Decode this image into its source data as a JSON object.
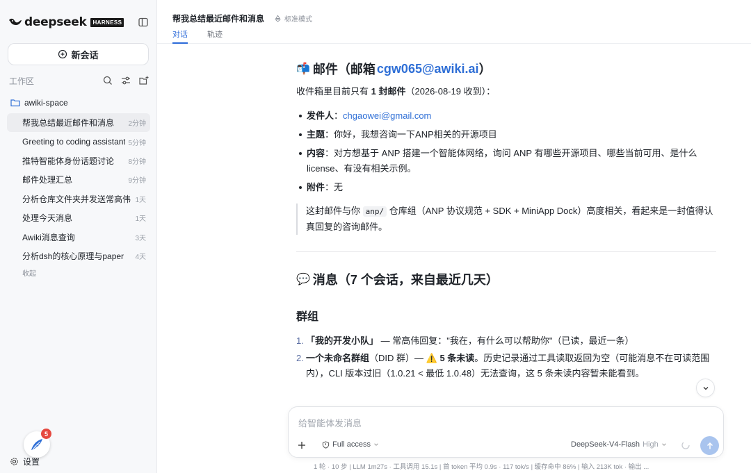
{
  "brand": {
    "name": "deepseek",
    "badge": "HARNESS"
  },
  "sidebar": {
    "new_chat_label": "新会话",
    "workspace_label": "工作区",
    "folder_name": "awiki-space",
    "conversations": [
      {
        "title": "帮我总结最近邮件和消息",
        "ago": "2分钟",
        "active": true
      },
      {
        "title": "Greeting to coding assistant",
        "ago": "5分钟"
      },
      {
        "title": "推特智能体身份话题讨论",
        "ago": "8分钟"
      },
      {
        "title": "邮件处理汇总",
        "ago": "9分钟"
      },
      {
        "title": "分析仓库文件夹并发送常高伟",
        "ago": "1天"
      },
      {
        "title": "处理今天消息",
        "ago": "1天"
      },
      {
        "title": "Awiki消息查询",
        "ago": "3天"
      },
      {
        "title": "分析dsh的核心原理与paper",
        "ago": "4天"
      }
    ],
    "collapse_label": "收起",
    "notification_count": "5",
    "settings_label": "设置"
  },
  "header": {
    "title": "帮我总结最近邮件和消息",
    "mode_label": "标准模式",
    "tabs": [
      "对话",
      "轨迹"
    ]
  },
  "content": {
    "mail_heading_emoji": "📬",
    "mail_heading": "邮件（邮箱 ",
    "mail_heading_email": "cgw065@awiki.ai",
    "mail_heading_end": "）",
    "inbox_prefix": "收件箱里目前只有 ",
    "inbox_count": "1 封邮件",
    "inbox_suffix": "（2026-08-19 收到）：",
    "sender_label": "发件人",
    "sender_value": "chgaowei@gmail.com",
    "subject_label": "主题",
    "subject_value": "你好，我想咨询一下ANP相关的开源项目",
    "body_label": "内容",
    "body_value": "对方想基于 ANP 搭建一个智能体网络，询问 ANP 有哪些开源项目、哪些当前可用、是什么 license、有没有相关示例。",
    "attach_label": "附件",
    "attach_value": "无",
    "quote_prefix": "这封邮件与你 ",
    "quote_code": "anp/",
    "quote_suffix": " 仓库组（ANP 协议规范 + SDK + MiniApp Dock）高度相关，看起来是一封值得认真回复的咨询邮件。",
    "msg_heading_emoji": "💬",
    "msg_heading": "消息（7 个会话，来自最近几天）",
    "group_heading": "群组",
    "item1_num": "1.",
    "item1_name": "「我的开发小队」",
    "item1_text": " — 常高伟回复：\"我在，有什么可以帮助你\"（已读，最近一条）",
    "item2_num": "2.",
    "item2_name": "一个未命名群组",
    "item2_mid": "（DID 群）— ",
    "item2_warn": "⚠️",
    "item2_bold": " 5 条未读",
    "item2_text": "。历史记录通过工具读取返回为空（可能消息不在可读范围内），CLI 版本过旧（1.0.21 < 最低 1.0.48）无法查询，这 5 条未读内容暂未能看到。"
  },
  "composer": {
    "placeholder": "给智能体发消息",
    "access_label": "Full access",
    "model_name": "DeepSeek-V4-Flash",
    "model_level": "High"
  },
  "status_bar": "1 轮 · 10 步  |  LLM 1m27s · 工具调用 15.1s  |  首 token 平均 0.9s · 117 tok/s  |  缓存命中 86%  |  输入 213K tok · 输出 ..."
}
